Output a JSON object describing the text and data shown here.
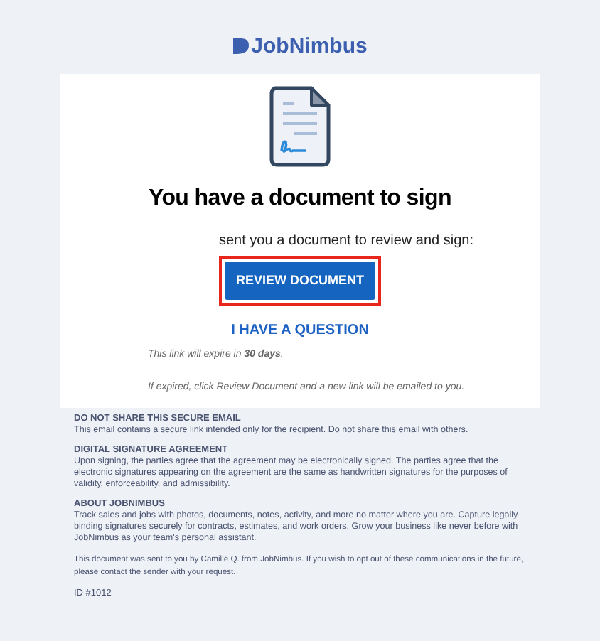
{
  "logo": {
    "text": "JobNimbus"
  },
  "card": {
    "title": "You have a document to sign",
    "intro": "sent you a document to review and sign:",
    "primary_button": {
      "label": "REVIEW DOCUMENT",
      "highlighted": true
    },
    "question_link": "I HAVE A QUESTION",
    "notes": [
      "This link will expire in **30 days**.",
      "If expired, click Review Document and a new link will be emailed to you."
    ]
  },
  "footer": {
    "sections": [
      {
        "heading": "DO NOT SHARE THIS SECURE EMAIL",
        "body": "This email contains a secure link intended only for the recipient. Do not share this email with others."
      },
      {
        "heading": "DIGITAL SIGNATURE AGREEMENT",
        "body": "Upon signing, the parties agree that the agreement may be electronically signed. The parties agree that the electronic signatures appearing on the agreement are the same as handwritten signatures for the purposes of validity, enforceability, and admissibility."
      },
      {
        "heading": "ABOUT JOBNIMBUS",
        "body": "Track sales and jobs with photos, documents, notes, activity, and more no matter where you are. Capture legally binding signatures securely for contracts, estimates, and work orders. Grow your business like never before with JobNimbus as your team's personal assistant."
      }
    ],
    "sender_note": "This document was sent to you by Camille Q. from JobNimbus. If you wish to opt out of these communications in the future, please contact the sender with your request.",
    "id": "ID #1012"
  }
}
